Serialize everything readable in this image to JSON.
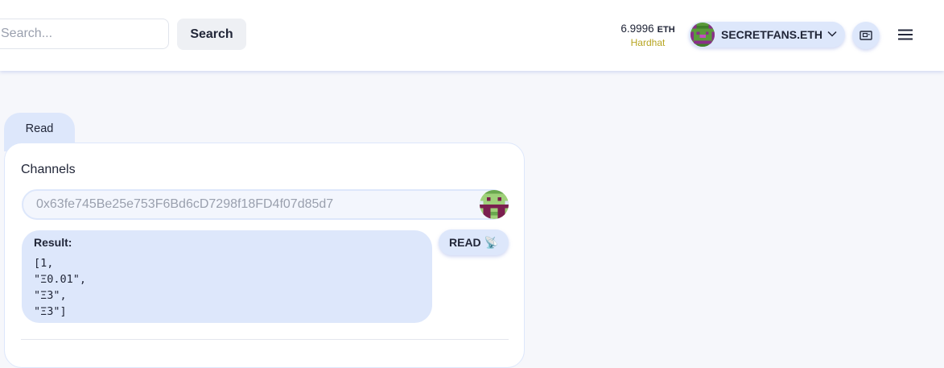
{
  "header": {
    "search": {
      "placeholder": "Search...",
      "button_label": "Search"
    },
    "balance": {
      "amount": "6.9996",
      "unit": "ETH",
      "network": "Hardhat",
      "network_color": "#b7a521"
    },
    "account": {
      "name": "SECRETFANS.ETH",
      "avatar_icon": "blockie-avatar-icon",
      "chevron_icon": "chevron-down-icon"
    },
    "qr_icon": "qr-code-icon",
    "menu_icon": "hamburger-menu-icon"
  },
  "tabs": [
    {
      "label": "Read"
    }
  ],
  "contract_function": {
    "name": "Channels",
    "input": {
      "placeholder": "0x63fe745Be25e753F6Bd6cD7298f18FD4f07d85d7",
      "value": ""
    },
    "result": {
      "label": "Result:",
      "value": "[1,\n\"Ξ0.01\",\n\"Ξ3\",\n\"Ξ3\"]"
    },
    "read_button_label": "READ 📡"
  },
  "colors": {
    "accent": "#dde7fb",
    "text": "#212638"
  }
}
